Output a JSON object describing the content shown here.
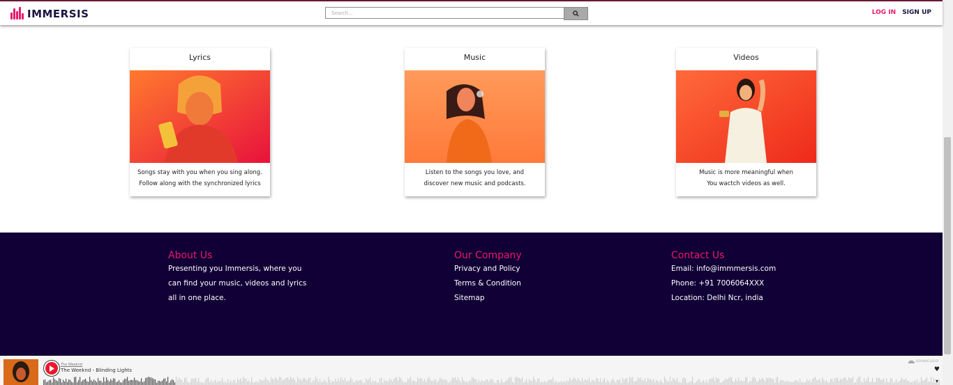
{
  "header": {
    "logo_text": "IMMERSIS",
    "search_placeholder": "Search...",
    "login_label": "LOG IN",
    "signup_label": "SIGN UP"
  },
  "cards": [
    {
      "title": "Lyrics",
      "desc_line1": "Songs stay with you when you sing along.",
      "desc_line2": "Follow along with the synchronized lyrics"
    },
    {
      "title": "Music",
      "desc_line1": "Listen to the songs you love, and",
      "desc_line2": "discover new music and podcasts."
    },
    {
      "title": "Videos",
      "desc_line1": "Music is more meaningful when",
      "desc_line2": "You wactch videos as well."
    }
  ],
  "footer": {
    "about": {
      "heading": "About Us",
      "lines": [
        "Presenting you Immersis, where you",
        "can find your music, videos and lyrics",
        "all in one place."
      ]
    },
    "company": {
      "heading": "Our Company",
      "links": [
        "Privacy and Policy",
        "Terms & Condition",
        "Sitemap"
      ]
    },
    "contact": {
      "heading": "Contact Us",
      "lines": [
        "Email: info@immmersis.com",
        "Phone: +91 7006064XXX",
        "Location: Delhi Ncr, india"
      ]
    }
  },
  "player": {
    "artist": "The Weeknd",
    "track": "The Weeknd - Blinding Lights",
    "brand": "SOUNDCLOUD"
  },
  "colors": {
    "accent": "#e8196b",
    "footer_bg": "#110036",
    "logo_text": "#1a1440"
  }
}
